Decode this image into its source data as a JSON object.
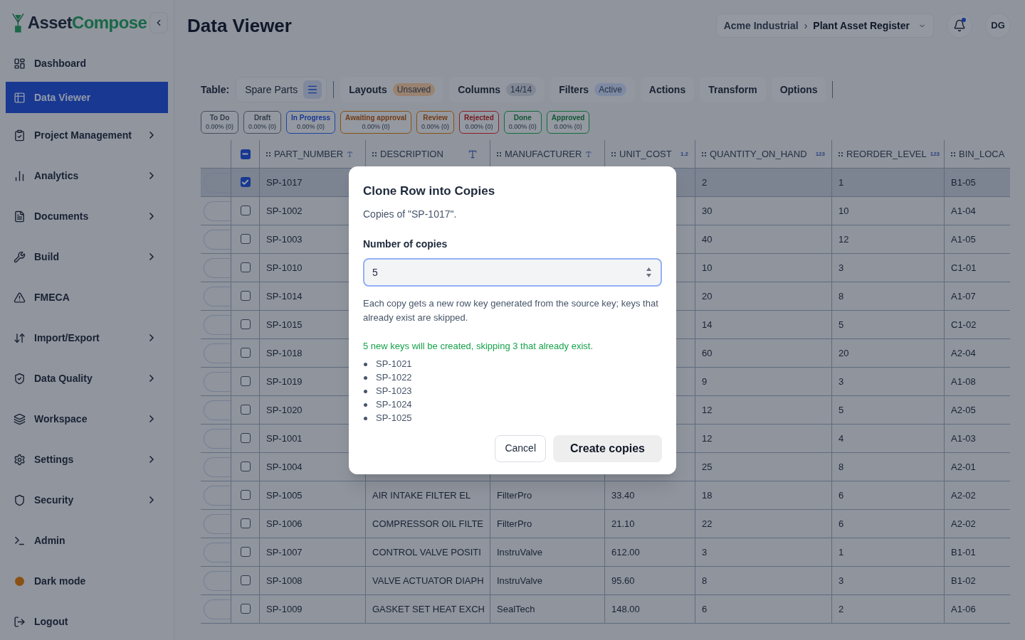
{
  "sidebar": {
    "brand": {
      "first": "Asset",
      "second": "Compose"
    },
    "items": [
      {
        "label": "Dashboard",
        "kind": "link",
        "selected": false
      },
      {
        "label": "Data Viewer",
        "kind": "link",
        "selected": true
      },
      {
        "label": "Project Management",
        "kind": "menu",
        "selected": false
      },
      {
        "label": "Analytics",
        "kind": "menu",
        "selected": false
      },
      {
        "label": "Documents",
        "kind": "menu",
        "selected": false
      },
      {
        "label": "Build",
        "kind": "menu",
        "selected": false
      },
      {
        "label": "FMECA",
        "kind": "link",
        "selected": false
      },
      {
        "label": "Import/Export",
        "kind": "menu",
        "selected": false
      },
      {
        "label": "Data Quality",
        "kind": "menu",
        "selected": false
      },
      {
        "label": "Workspace",
        "kind": "menu",
        "selected": false
      },
      {
        "label": "Settings",
        "kind": "menu",
        "selected": false
      },
      {
        "label": "Security",
        "kind": "menu",
        "selected": false
      },
      {
        "label": "Admin",
        "kind": "link",
        "selected": false
      },
      {
        "label": "Dark mode",
        "kind": "toggle",
        "selected": false
      },
      {
        "label": "Logout",
        "kind": "link",
        "selected": false
      }
    ]
  },
  "header": {
    "title": "Data Viewer",
    "breadcrumb": [
      "Acme Industrial",
      "Plant Asset Register"
    ],
    "separator": "›",
    "notifications_unread": true,
    "avatar": "DG"
  },
  "toolbar": {
    "table_label": "Table:",
    "table_name": "Spare Parts",
    "buttons": [
      {
        "label": "Layouts",
        "badge": {
          "text": "Unsaved",
          "kind": "warning"
        }
      },
      {
        "label": "Columns",
        "badge": {
          "text": "14/14",
          "kind": "neutral"
        }
      },
      {
        "label": "Filters",
        "badge": {
          "text": "Active",
          "kind": "info"
        }
      },
      {
        "label": "Actions"
      },
      {
        "label": "Transform"
      },
      {
        "label": "Options"
      }
    ]
  },
  "statuses": [
    {
      "label": "To Do",
      "value": "0.00% (0)",
      "kind": "gray"
    },
    {
      "label": "Draft",
      "value": "0.00% (0)",
      "kind": "gray"
    },
    {
      "label": "In Progress",
      "value": "0.00% (0)",
      "kind": "blue"
    },
    {
      "label": "Awaiting approval",
      "value": "0.00% (0)",
      "kind": "amber"
    },
    {
      "label": "Review",
      "value": "0.00% (0)",
      "kind": "amber"
    },
    {
      "label": "Rejected",
      "value": "0.00% (0)",
      "kind": "red"
    },
    {
      "label": "Done",
      "value": "0.00% (0)",
      "kind": "green"
    },
    {
      "label": "Approved",
      "value": "0.00% (0)",
      "kind": "green"
    }
  ],
  "table": {
    "select_all": {
      "indeterminate": true
    },
    "columns": [
      {
        "name": "PART_NUMBER",
        "kind": "text"
      },
      {
        "name": "DESCRIPTION",
        "kind": "text"
      },
      {
        "name": "MANUFACTURER",
        "kind": "text"
      },
      {
        "name": "UNIT_COST",
        "kind": "number",
        "type_label": "1.2"
      },
      {
        "name": "QUANTITY_ON_HAND",
        "kind": "number",
        "type_label": "123"
      },
      {
        "name": "REORDER_LEVEL",
        "kind": "number",
        "type_label": "123"
      },
      {
        "name": "BIN_LOCA",
        "kind": "plain"
      }
    ],
    "rows": [
      {
        "selected": true,
        "cells": [
          "SP-1017",
          null,
          null,
          null,
          "2",
          "1",
          "B1-05"
        ]
      },
      {
        "selected": false,
        "cells": [
          "SP-1002",
          null,
          null,
          null,
          "30",
          "10",
          "A1-04"
        ]
      },
      {
        "selected": false,
        "cells": [
          "SP-1003",
          null,
          null,
          null,
          "40",
          "12",
          "A1-05"
        ]
      },
      {
        "selected": false,
        "cells": [
          "SP-1010",
          null,
          null,
          null,
          "10",
          "3",
          "C1-01"
        ]
      },
      {
        "selected": false,
        "cells": [
          "SP-1014",
          null,
          null,
          null,
          "20",
          "8",
          "A1-07"
        ]
      },
      {
        "selected": false,
        "cells": [
          "SP-1015",
          null,
          null,
          null,
          "14",
          "5",
          "C1-02"
        ]
      },
      {
        "selected": false,
        "cells": [
          "SP-1018",
          null,
          null,
          null,
          "60",
          "20",
          "A2-04"
        ]
      },
      {
        "selected": false,
        "cells": [
          "SP-1019",
          null,
          null,
          null,
          "9",
          "3",
          "A1-08"
        ]
      },
      {
        "selected": false,
        "cells": [
          "SP-1020",
          null,
          null,
          null,
          "12",
          "5",
          "A2-05"
        ]
      },
      {
        "selected": false,
        "cells": [
          "SP-1001",
          null,
          null,
          null,
          "12",
          "4",
          "A1-03"
        ]
      },
      {
        "selected": false,
        "cells": [
          "SP-1004",
          null,
          null,
          null,
          "25",
          "8",
          "A2-01"
        ]
      },
      {
        "selected": false,
        "cells": [
          "SP-1005",
          "AIR INTAKE FILTER EL",
          "FilterPro",
          "33.40",
          "18",
          "6",
          "A2-02"
        ]
      },
      {
        "selected": false,
        "cells": [
          "SP-1006",
          "COMPRESSOR OIL FILTE",
          "FilterPro",
          "21.10",
          "22",
          "6",
          "A2-02"
        ]
      },
      {
        "selected": false,
        "cells": [
          "SP-1007",
          "CONTROL VALVE POSITI",
          "InstruValve",
          "612.00",
          "3",
          "1",
          "B1-01"
        ]
      },
      {
        "selected": false,
        "cells": [
          "SP-1008",
          "VALVE ACTUATOR DIAPH",
          "InstruValve",
          "95.60",
          "8",
          "3",
          "B1-02"
        ]
      },
      {
        "selected": false,
        "cells": [
          "SP-1009",
          "GASKET SET HEAT EXCH",
          "SealTech",
          "148.00",
          "6",
          "2",
          "A1-06"
        ]
      }
    ]
  },
  "dialog": {
    "title": "Clone Row into Copies",
    "subtitle": "Copies of \"SP-1017\".",
    "field_label": "Number of copies",
    "field_value": "5",
    "help": "Each copy gets a new row key generated from the source key; keys that already exist are skipped.",
    "summary": "5 new keys will be created, skipping 3 that already exist.",
    "keys": [
      "SP-1021",
      "SP-1022",
      "SP-1023",
      "SP-1024",
      "SP-1025"
    ],
    "cancel": "Cancel",
    "confirm": "Create copies"
  }
}
